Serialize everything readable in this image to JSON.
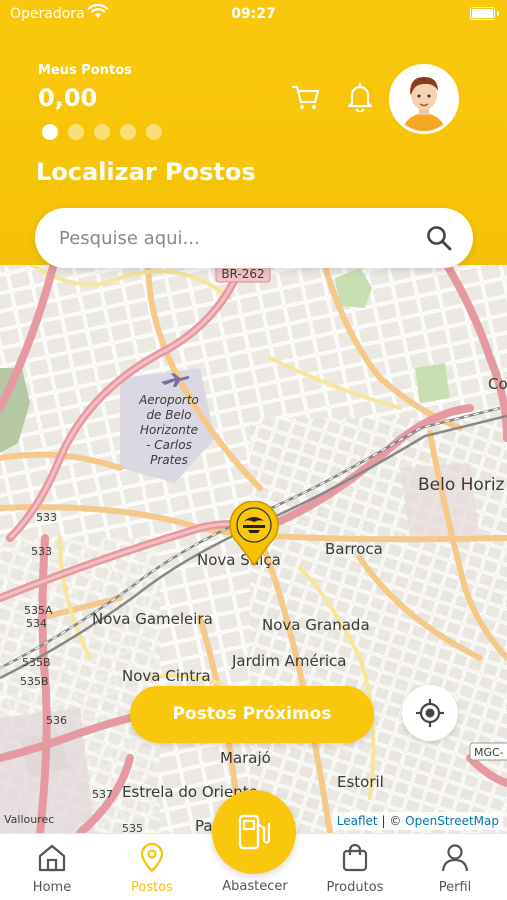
{
  "status_bar": {
    "carrier": "Operadora",
    "time": "09:27"
  },
  "points": {
    "label": "Meus Pontos",
    "value": "0,00",
    "carousel_total": 5,
    "carousel_active": 1
  },
  "section_title": "Localizar Postos",
  "search": {
    "placeholder": "Pesquise aqui..."
  },
  "map": {
    "labels": {
      "br262": "BR-262",
      "airport": [
        "Aeroporto",
        "de Belo",
        "Horizonte",
        "- Carlos",
        "Prates"
      ],
      "belo_horizonte": "Belo Horiz",
      "co": "Co",
      "barroca": "Barroca",
      "nova_suica": "Nova Suíça",
      "nova_gameleira": "Nova Gameleira",
      "nova_granada": "Nova Granada",
      "jardim_america": "Jardim América",
      "nova_cintra": "Nova Cintra",
      "marajo": "Marajó",
      "estoril": "Estoril",
      "estrela_do_oriente": "Estrela do Oriente",
      "pa": "Pa",
      "vallourec": "Vallourec",
      "mgc": "MGC-",
      "road_533a": "533",
      "road_533b": "533",
      "road_535a": "535A",
      "road_534": "534",
      "road_535b": "535B",
      "road_535b2": "535B",
      "road_536": "536",
      "road_537": "537",
      "road_535": "535"
    },
    "attribution": {
      "leaflet": "Leaflet",
      "separator": "| ©",
      "osm": "OpenStreetMap"
    }
  },
  "buttons": {
    "nearby": "Postos Próximos"
  },
  "nav": {
    "home": "Home",
    "postos": "Postos",
    "abastecer": "Abastecer",
    "produtos": "Produtos",
    "perfil": "Perfil",
    "active": "postos"
  },
  "colors": {
    "brand_yellow": "#f9c70c",
    "road_pink": "#e8a3a9",
    "road_orange": "#f5c98a"
  }
}
